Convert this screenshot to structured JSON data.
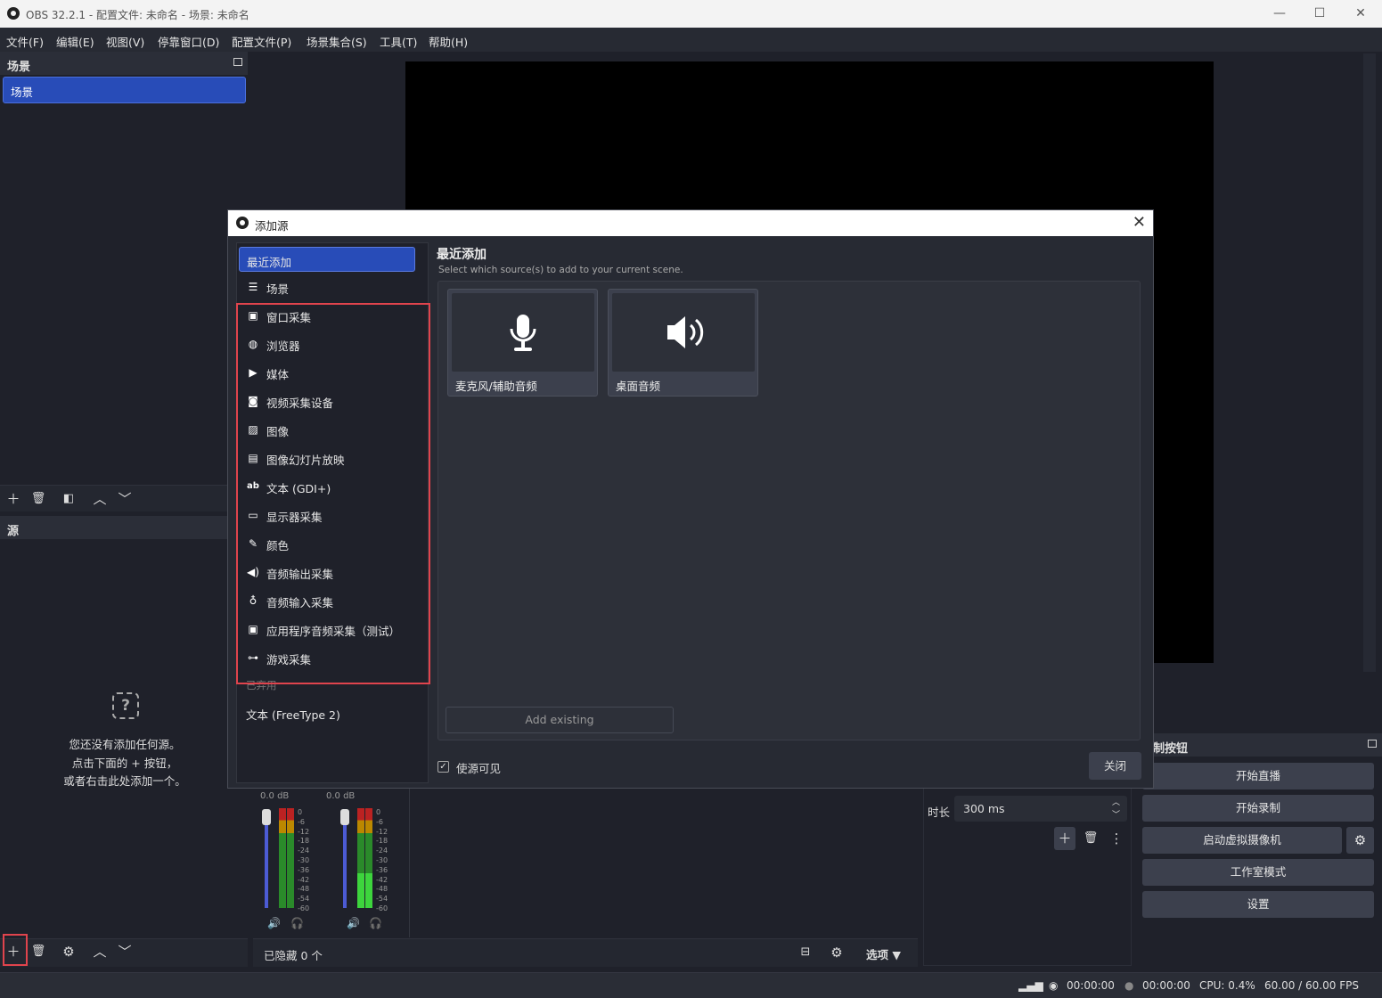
{
  "window": {
    "title": "OBS 32.2.1 - 配置文件: 未命名 - 场景: 未命名"
  },
  "menu": [
    "文件(F)",
    "编辑(E)",
    "视图(V)",
    "停靠窗口(D)",
    "配置文件(P)",
    "场景集合(S)",
    "工具(T)",
    "帮助(H)"
  ],
  "scenes": {
    "title": "场景",
    "items": [
      "场景"
    ]
  },
  "sources": {
    "title": "源",
    "empty_lines": [
      "您还没有添加任何源。",
      "点击下面的 + 按钮，",
      "或者右击此处添加一个。"
    ]
  },
  "mixer": {
    "channels": [
      {
        "db": "0.0 dB"
      },
      {
        "db": "0.0 dB"
      }
    ],
    "ticks": [
      "0",
      "-6",
      "-12",
      "-18",
      "-24",
      "-30",
      "-36",
      "-42",
      "-48",
      "-54",
      "-60"
    ],
    "hidden_label": "已隐藏 0 个",
    "options_label": "选项"
  },
  "transitions": {
    "duration_label": "时长",
    "duration_value": "300 ms"
  },
  "controls": {
    "title": "制按钮",
    "buttons": [
      "开始直播",
      "开始录制",
      "启动虚拟摄像机",
      "工作室模式",
      "设置"
    ]
  },
  "status": {
    "stream_time": "00:00:00",
    "rec_time": "00:00:00",
    "cpu": "CPU: 0.4%",
    "fps": "60.00 / 60.00 FPS"
  },
  "dialog": {
    "title": "添加源",
    "heading": "最近添加",
    "subtitle": "Select which source(s) to add to your current scene.",
    "list_selected": "最近添加",
    "list_scene": "场景",
    "list_items": [
      "窗口采集",
      "浏览器",
      "媒体",
      "视频采集设备",
      "图像",
      "图像幻灯片放映",
      "文本 (GDI+)",
      "显示器采集",
      "颜色",
      "音频输出采集",
      "音频输入采集",
      "应用程序音频采集（测试）",
      "游戏采集"
    ],
    "deprecated_label": "已弃用",
    "deprecated_item": "文本 (FreeType 2)",
    "recent_cards": [
      "麦克风/辅助音频",
      "桌面音频"
    ],
    "add_existing": "Add existing",
    "visible_label": "使源可见",
    "close_label": "关闭"
  }
}
